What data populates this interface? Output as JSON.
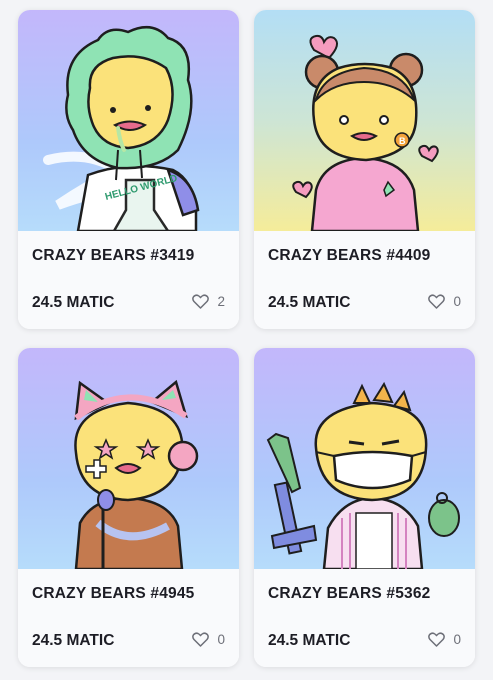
{
  "items": [
    {
      "title": "CRAZY BEARS #3419",
      "price": "24.5 MATIC",
      "likes": "2",
      "background": "purple",
      "icon": "heart-icon"
    },
    {
      "title": "CRAZY BEARS #4409",
      "price": "24.5 MATIC",
      "likes": "0",
      "background": "teal-yellow",
      "icon": "heart-icon"
    },
    {
      "title": "CRAZY BEARS #4945",
      "price": "24.5 MATIC",
      "likes": "0",
      "background": "purple",
      "icon": "heart-icon"
    },
    {
      "title": "CRAZY BEARS #5362",
      "price": "24.5 MATIC",
      "likes": "0",
      "background": "purple",
      "icon": "heart-icon"
    }
  ],
  "colors": {
    "bear_yellow": "#fbe27a",
    "outline": "#1e1e1e",
    "text": "#1d1d25",
    "muted": "#6d6f78"
  }
}
